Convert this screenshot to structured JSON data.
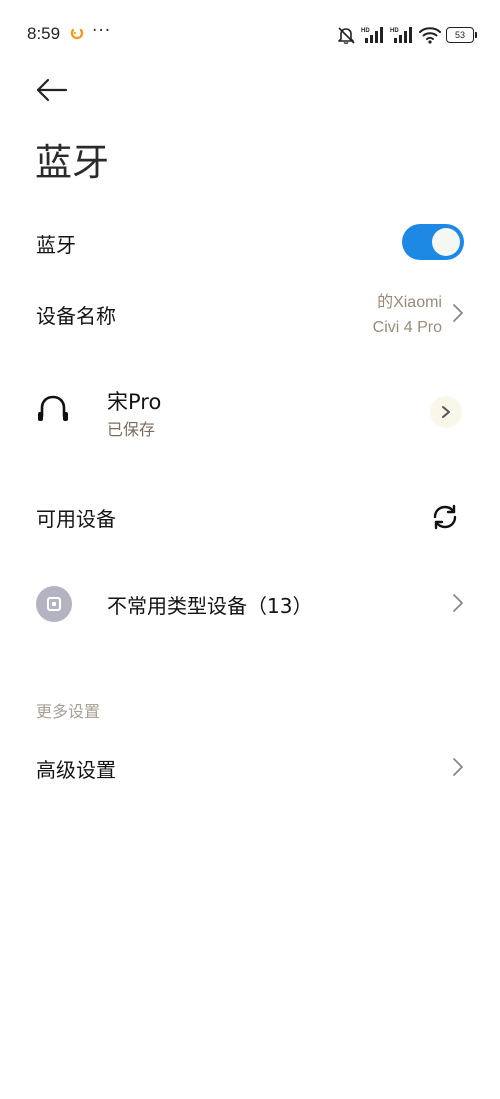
{
  "status_bar": {
    "time": "8:59",
    "more": "···",
    "battery": "53",
    "icons": [
      "bell-off-icon",
      "hd-signal-icon",
      "hd-signal-icon",
      "wifi-icon",
      "battery-icon"
    ]
  },
  "header": {
    "back_icon": "arrow-left-icon",
    "title": "蓝牙"
  },
  "bluetooth_row": {
    "label": "蓝牙",
    "toggle_on": true,
    "toggle_color": "#1e88e5"
  },
  "device_name_row": {
    "label": "设备名称",
    "value_line1": "的Xiaomi",
    "value_line2": "Civi 4 Pro"
  },
  "saved_device": {
    "icon": "headphones-icon",
    "name": "宋Pro",
    "status": "已保存"
  },
  "available_devices": {
    "label": "可用设备",
    "icon": "refresh-icon"
  },
  "uncommon_devices": {
    "label": "不常用类型设备（13）",
    "icon": "device-square-icon"
  },
  "more_settings": {
    "section_label": "更多设置",
    "advanced_label": "高级设置"
  }
}
